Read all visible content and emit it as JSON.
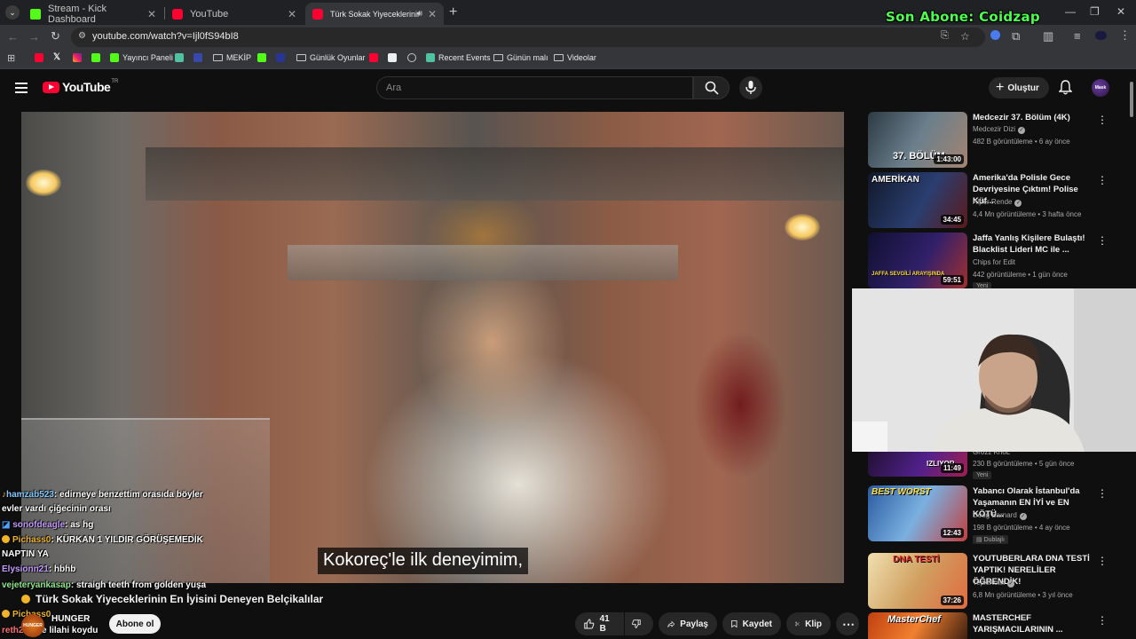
{
  "browser": {
    "tabs": [
      {
        "title": "Stream - Kick Dashboard",
        "favicon": "kick-icon"
      },
      {
        "title": "YouTube",
        "favicon": "youtube-icon"
      },
      {
        "title": "Türk Sokak Yiyeceklerinin E",
        "favicon": "youtube-icon",
        "active": true
      }
    ],
    "url": "youtube.com/watch?v=Ijl0fS94bI8",
    "bookmarks": [
      "Yayıncı Paneli",
      "MEKİP",
      "Günlük Oyunlar",
      "Recent Events",
      "Günün malı",
      "Videolar"
    ]
  },
  "overlay": {
    "son_abone": "Son Abone: Coidzap"
  },
  "youtube": {
    "logo_text": "YouTube",
    "logo_region": "TR",
    "search_placeholder": "Ara",
    "create_label": "Oluştur",
    "avatar_text": "Mask"
  },
  "video": {
    "subtitle": "Kokoreç'le ilk deneyimim,",
    "title": "Türk Sokak Yiyeceklerinin En İyisini Deneyen Belçikalılar",
    "channel": "HUNGER",
    "channel_avatar_text": "HUNGER",
    "subscribe_label": "Abone ol",
    "likes": "41 B",
    "share_label": "Paylaş",
    "save_label": "Kaydet",
    "clip_label": "Klip"
  },
  "chat": [
    {
      "user": "hamzab523",
      "message": ": edirneye benzettim orasıda böyler"
    },
    {
      "user": "",
      "message": "evler vardı çiğecinin orası"
    },
    {
      "user": "sonofdeagle",
      "message": ": as hg"
    },
    {
      "user": "Pichass0",
      "message": ": KÜRKAN 1 YILDIR GÖRÜŞEMEDİK"
    },
    {
      "user": "",
      "message": "NAPTIN YA"
    },
    {
      "user": "Elysionn21",
      "message": ": hbhb"
    },
    {
      "user": "vejeteryankasap",
      "message": ": straigh teeth from golden yuşa"
    },
    {
      "user": "Pichass0",
      "message": ""
    },
    {
      "user": "reth2",
      "message": ": niye lilahi koydu"
    }
  ],
  "recommendations": [
    {
      "title": "Medcezir 37. Bölüm (4K)",
      "channel": "Medcezir Dizi",
      "verified": true,
      "meta": "482 B görüntüleme • 6 ay önce",
      "duration": "1:43:00",
      "thumb_text": "37. BÖLÜM"
    },
    {
      "title": "Amerika'da Polisle Gece Devriyesine Çıktım! Polise Küf...",
      "channel": "Alper Rende",
      "verified": true,
      "meta": "4,4 Mn görüntüleme • 3 hafta önce",
      "duration": "34:45",
      "thumb_text": "AMERİKAN"
    },
    {
      "title": "Jaffa Yanlış Kişilere Bulaştı! Blacklist Lideri MC ile ...",
      "channel": "Chips for Edit",
      "verified": false,
      "meta": "442 görüntüleme • 1 gün önce",
      "duration": "59:51",
      "tag": "Yeni",
      "thumb_text": "JAFFA SEVGİLİ ARAYIŞINDA"
    },
    {
      "title": "",
      "channel": "Gr0zz KnoL",
      "verified": false,
      "meta": "230 B görüntüleme • 5 gün önce",
      "duration": "11:49",
      "tag": "Yeni",
      "thumb_text": "IZLIYOR"
    },
    {
      "title": "Yabancı Olarak İstanbul'da Yaşamanın EN İYİ ve EN KÖTÜ...",
      "channel": "Doug Barnard",
      "verified": true,
      "meta": "198 B görüntüleme • 4 ay önce",
      "duration": "12:43",
      "tag": "Dublajlı",
      "thumb_text": "BEST WORST"
    },
    {
      "title": "YOUTUBERLARA DNA TESTİ YAPTIK! NERELİLER ÖĞRENDİK!",
      "channel": "TepkiKolik",
      "verified": true,
      "meta": "6,8 Mn görüntüleme • 3 yıl önce",
      "duration": "37:26",
      "thumb_text": "DNA TESTİ"
    },
    {
      "title": "MASTERCHEF YARIŞMACILARININ ...",
      "channel": "",
      "verified": false,
      "meta": "",
      "duration": "",
      "thumb_text": "MasterChef"
    }
  ]
}
